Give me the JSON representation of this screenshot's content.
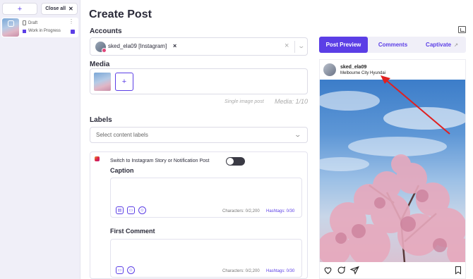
{
  "sidebar": {
    "add_label": "+",
    "close_all_label": "Close all",
    "close_all_icon": "✕",
    "draft": {
      "status": "Draft",
      "label": "Work in Progress"
    }
  },
  "main": {
    "title": "Create Post",
    "accounts": {
      "label": "Accounts",
      "selected": "sked_ela09 [Instagram]",
      "remove_icon": "×"
    },
    "media": {
      "label": "Media",
      "add_label": "+",
      "note": "Single image post",
      "count": "Media: 1/10"
    },
    "labels": {
      "label": "Labels",
      "placeholder": "Select content labels"
    },
    "instagram": {
      "switch_text": "Switch to Instagram Story or Notification Post",
      "caption_label": "Caption",
      "caption_chars": "Characters: 0/2,200",
      "caption_hashtags": "Hashtags: 0/30",
      "first_comment_label": "First Comment",
      "comment_chars": "Characters: 0/2,200",
      "comment_hashtags": "Hashtags: 0/30"
    }
  },
  "preview": {
    "tabs": [
      {
        "label": "Post Preview",
        "active": true
      },
      {
        "label": "Comments",
        "active": false
      },
      {
        "label": "Captivate",
        "active": false
      }
    ],
    "username": "sked_ela09",
    "location": "Melbourne City Hyundai"
  },
  "colors": {
    "accent": "#5b3ee6",
    "sidebar_bg": "#f0eff8",
    "annotation_arrow": "#e02020"
  }
}
